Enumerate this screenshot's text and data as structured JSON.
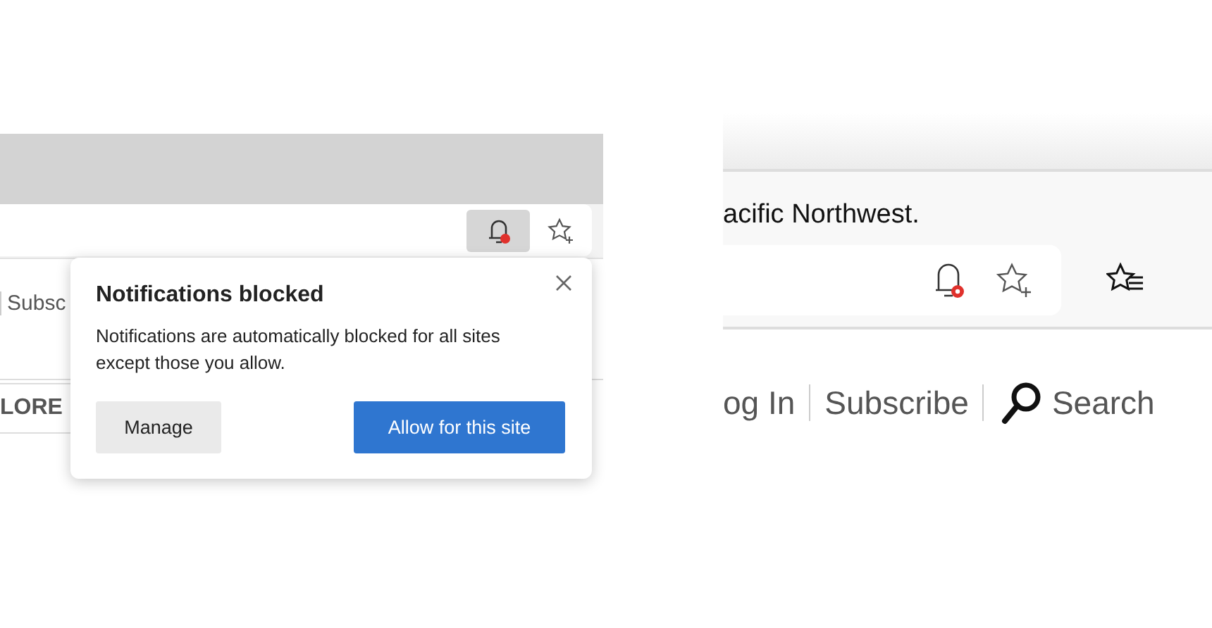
{
  "left": {
    "bell": {
      "active": true,
      "blocked": true
    },
    "page_texts": [
      "Subsc",
      "LORE"
    ],
    "popup": {
      "title": "Notifications blocked",
      "message": "Notifications are automatically blocked for all sites except those you allow.",
      "buttons": [
        {
          "label": "Manage",
          "kind": "secondary"
        },
        {
          "label": "Allow for this site",
          "kind": "primary"
        }
      ]
    }
  },
  "right": {
    "bell": {
      "active": false,
      "blocked": true
    },
    "page_text": "acific Northwest.",
    "nav": [
      {
        "label": "og In",
        "kind": "link"
      },
      {
        "label": "Subscribe",
        "kind": "link"
      },
      {
        "label": "Search",
        "kind": "search"
      }
    ]
  }
}
